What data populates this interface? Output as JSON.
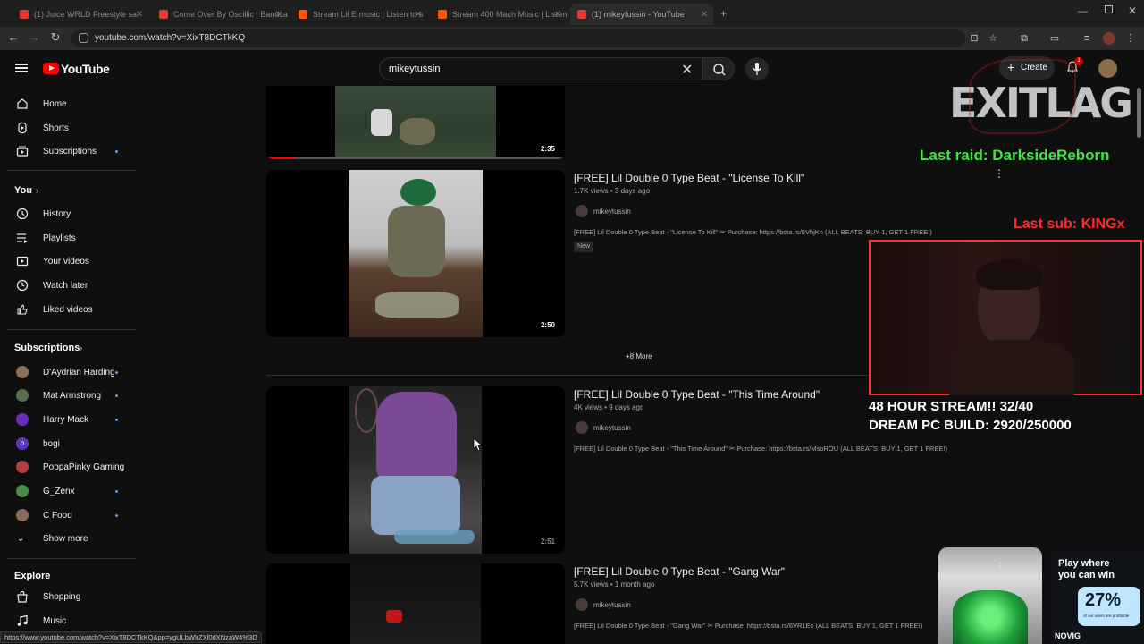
{
  "browser": {
    "tabs": [
      {
        "title": "(1) Juice WRLD Freestyle sa"
      },
      {
        "title": "Come Over By Oscillic | Bandcamp"
      },
      {
        "title": "Stream Lil E music | Listen to s"
      },
      {
        "title": "Stream 400 Mach Music | Listen"
      },
      {
        "title": "(1) mikeytussin - YouTube"
      }
    ],
    "url": "youtube.com/watch?v=XixT8DCTkKQ",
    "status_url": "https://www.youtube.com/watch?v=XixT8DCTkKQ&pp=ygULbWlrZXl0dXNzaW4%3D"
  },
  "header": {
    "logo": "YouTube",
    "search_value": "mikeytussin",
    "create_label": "Create",
    "notification_count": "1"
  },
  "sidebar": {
    "main": [
      {
        "label": "Home",
        "icon": "home-icon"
      },
      {
        "label": "Shorts",
        "icon": "shorts-icon"
      },
      {
        "label": "Subscriptions",
        "icon": "subscriptions-icon"
      }
    ],
    "you_heading": "You",
    "you_items": [
      {
        "label": "History",
        "icon": "history-icon"
      },
      {
        "label": "Playlists",
        "icon": "playlists-icon"
      },
      {
        "label": "Your videos",
        "icon": "your-videos-icon"
      },
      {
        "label": "Watch later",
        "icon": "watch-later-icon"
      },
      {
        "label": "Liked videos",
        "icon": "liked-icon"
      }
    ],
    "subs_heading": "Subscriptions",
    "subs": [
      {
        "label": "D'Aydrian Harding",
        "color": "#8a6f5a",
        "dot": true
      },
      {
        "label": "Mat Armstrong",
        "color": "#5a6e4a",
        "dot": true
      },
      {
        "label": "Harry Mack",
        "color": "#6a2bbd",
        "dot": true
      },
      {
        "label": "bogi",
        "color": "#5b35c7",
        "dot": false,
        "letter": "b"
      },
      {
        "label": "PoppaPinky Gaming",
        "color": "#b04040",
        "dot": false
      },
      {
        "label": "G_Zenx",
        "color": "#4b8b4b",
        "dot": true
      },
      {
        "label": "C Food",
        "color": "#8a6a5a",
        "dot": true
      }
    ],
    "show_more": "Show more",
    "explore_heading": "Explore",
    "explore": [
      {
        "label": "Shopping",
        "icon": "shopping-icon"
      },
      {
        "label": "Music",
        "icon": "music-icon"
      }
    ]
  },
  "videos": [
    {
      "duration": "2:35"
    },
    {
      "title": "[FREE] Lil Double 0 Type Beat - \"License To Kill\"",
      "meta": "1.7K views • 3 days ago",
      "channel": "mikeytussin",
      "desc": "[FREE] Lil Double 0 Type Beat - \"License To Kill\" ✂ Purchase: https://bsta.rs/8VhjKn (ALL BEATS: BUY 1, GET 1 FREE!)",
      "badge": "New",
      "duration": "2:50"
    },
    {
      "title": "[FREE] Lil Double 0 Type Beat - \"This Time Around\"",
      "meta": "4K views • 9 days ago",
      "channel": "mikeytussin",
      "desc": "[FREE] Lil Double 0 Type Beat - \"This Time Around\" ✂ Purchase: https://bsta.rs/MsoROU (ALL BEATS: BUY 1, GET 1 FREE!)",
      "duration": "2:51"
    },
    {
      "title": "[FREE] Lil Double 0 Type Beat - \"Gang War\"",
      "meta": "5.7K views • 1 month ago",
      "channel": "mikeytussin",
      "desc": "[FREE] Lil Double 0 Type Beat - \"Gang War\" ✂ Purchase: https://bsta.rs/6VR1Ex (ALL BEATS: BUY 1, GET 1 FREE!)"
    }
  ],
  "more_label": "+8 More",
  "overlay": {
    "logo_text": "EXITLAG",
    "last_raid": "Last raid: DarksideReborn",
    "last_sub": "Last sub: KINGx",
    "stream_line1": "48 HOUR STREAM!! 32/40",
    "stream_line2": "DREAM PC BUILD: 2920/250000",
    "ad_line1": "Play where",
    "ad_line2": "you can win",
    "ad_pct": "27%",
    "ad_small": "of our users are profitable",
    "ad_brand": "NOVIG"
  }
}
